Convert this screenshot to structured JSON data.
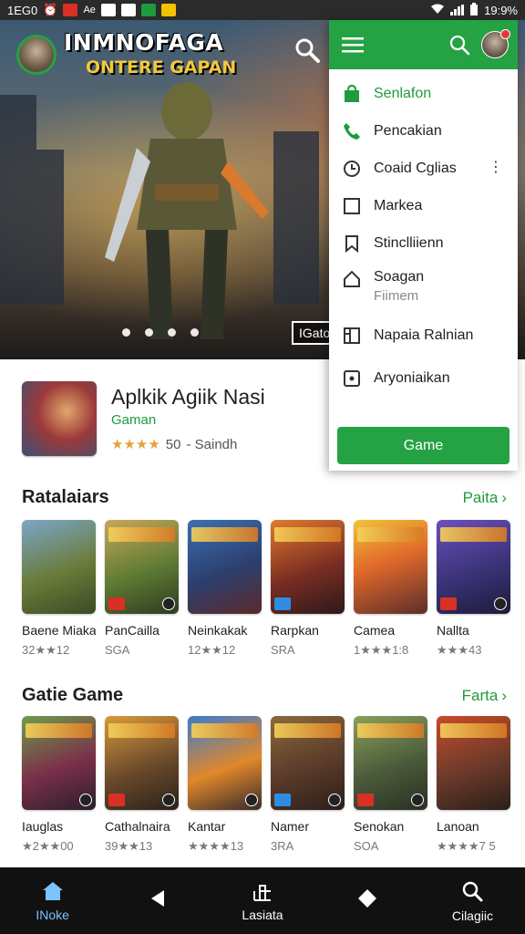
{
  "status_bar": {
    "left_text": "1EG0",
    "time": "19:9%"
  },
  "hero": {
    "title": "INMNOFAGA",
    "subtitle": "ONTERE GAPAN",
    "tag": "IGato",
    "dots": 4
  },
  "featured": {
    "name": "Aplkik Agiik Nasi",
    "category": "Gaman",
    "stars": "★★★★",
    "rating": "50",
    "developer": "- Saindh"
  },
  "section1": {
    "title": "Ratalaiars",
    "more": "Paita",
    "cards": [
      {
        "name": "Baene Miaka",
        "meta": "32★★12"
      },
      {
        "name": "PanCailla",
        "meta": "SGA"
      },
      {
        "name": "Neinkakak",
        "meta": "12★★12"
      },
      {
        "name": "Rarpkan",
        "meta": "SRA"
      },
      {
        "name": "Camea",
        "meta": "1★★★1:8"
      },
      {
        "name": "Nallta",
        "meta": "★★★43"
      }
    ]
  },
  "section2": {
    "title": "Gatie Game",
    "more": "Farta",
    "cards": [
      {
        "name": "Iauglas",
        "meta": "★2★★00"
      },
      {
        "name": "Cathalnaira",
        "meta": "39★★13"
      },
      {
        "name": "Kantar",
        "meta": "★★★★13"
      },
      {
        "name": "Namer",
        "meta": "3RA"
      },
      {
        "name": "Senokan",
        "meta": "SOA"
      },
      {
        "name": "Lanoan",
        "meta": "★★★★7 5"
      }
    ]
  },
  "bottom_nav": [
    {
      "label": "INoke",
      "icon": "home-icon"
    },
    {
      "label": "",
      "icon": "back-icon"
    },
    {
      "label": "Lasiata",
      "icon": "library-icon"
    },
    {
      "label": "",
      "icon": "recents-icon"
    },
    {
      "label": "Cilagiic",
      "icon": "search-icon"
    }
  ],
  "menu": {
    "items": [
      {
        "label": "Senlafon",
        "icon": "bag-icon"
      },
      {
        "label": "Pencakian",
        "icon": "phone-icon"
      },
      {
        "label": "Coaid Cglias",
        "icon": "clock-icon"
      },
      {
        "label": "Markea",
        "icon": "checkbox-icon"
      },
      {
        "label": "Stinclliienn",
        "icon": "bookmark-icon"
      },
      {
        "label": "Soagan",
        "sub": "Fiimem",
        "icon": "house-icon"
      },
      {
        "label": "Napaia Ralnian",
        "icon": "grid-icon"
      },
      {
        "label": "Aryoniaikan",
        "icon": "target-icon"
      }
    ],
    "button": "Game"
  },
  "colors": {
    "accent": "#25a244",
    "star": "#e3a33b",
    "nav_bg": "#111111"
  }
}
